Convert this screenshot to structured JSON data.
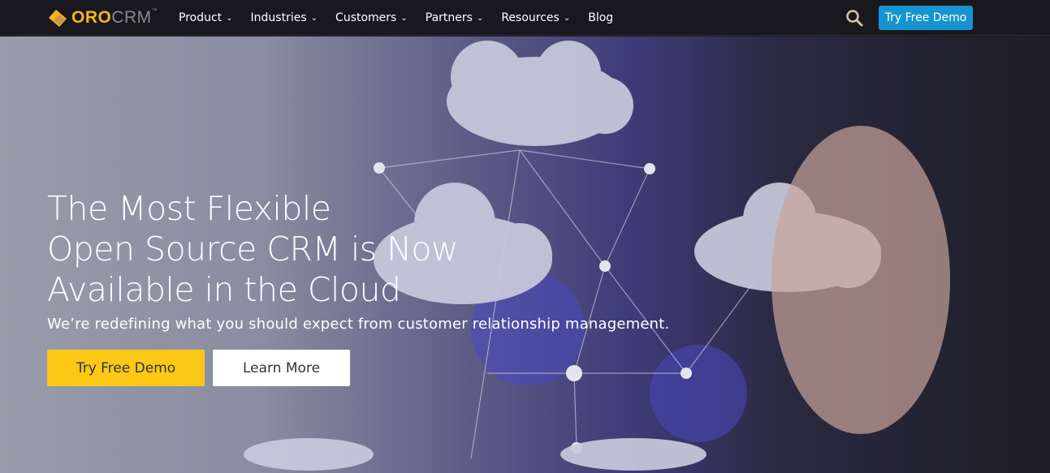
{
  "brand": {
    "name_part1": "ORO",
    "name_part2": "CRM",
    "trademark": "™",
    "accent": "#f5b51a"
  },
  "nav": {
    "items": [
      {
        "label": "Product"
      },
      {
        "label": "Industries"
      },
      {
        "label": "Customers"
      },
      {
        "label": "Partners"
      },
      {
        "label": "Resources"
      },
      {
        "label": "Blog"
      }
    ],
    "cta": "Try Free Demo",
    "cta_color": "#1694d0"
  },
  "hero": {
    "title_lines": [
      "The Most Flexible",
      "Open Source CRM is Now",
      "Available in the Cloud"
    ],
    "subtitle": "We’re redefining what you should expect from customer relationship management.",
    "primary_button": "Try Free Demo",
    "primary_color": "#fdc716",
    "secondary_button": "Learn More"
  }
}
